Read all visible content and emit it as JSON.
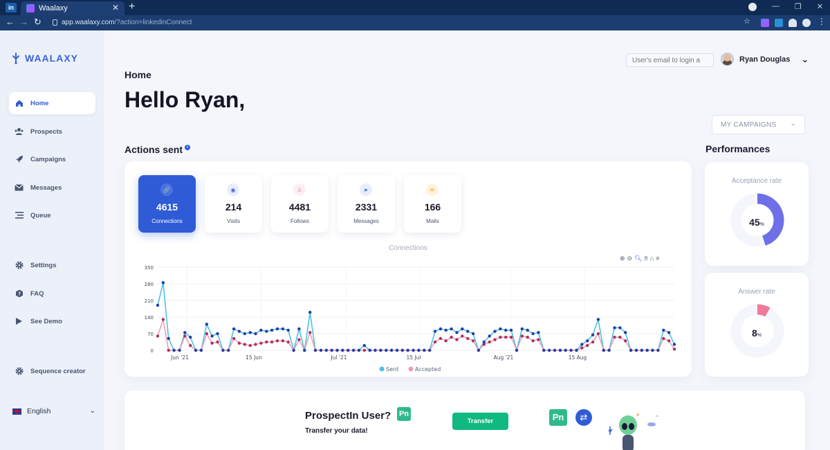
{
  "browser": {
    "tab_title": "Waalaxy",
    "url_host": "app.waalaxy.com",
    "url_path": "/?action=linkedinConnect"
  },
  "sidebar": {
    "logo_text": "WAALAXY",
    "items": [
      {
        "label": "Home",
        "icon": "home-icon",
        "active": true
      },
      {
        "label": "Prospects",
        "icon": "users-icon"
      },
      {
        "label": "Campaigns",
        "icon": "rocket-icon"
      },
      {
        "label": "Messages",
        "icon": "envelope-icon"
      },
      {
        "label": "Queue",
        "icon": "queue-icon"
      },
      {
        "label": "Settings",
        "icon": "gear-icon"
      },
      {
        "label": "FAQ",
        "icon": "question-icon"
      },
      {
        "label": "See Demo",
        "icon": "play-icon"
      },
      {
        "label": "Sequence creator",
        "icon": "gear-icon"
      }
    ],
    "language": "English"
  },
  "header": {
    "section_label": "Home",
    "greeting": "Hello Ryan,",
    "login_placeholder": "User's email to login a",
    "user_name": "Ryan Douglas"
  },
  "campaign_select": {
    "value": "MY CAMPAIGNS"
  },
  "actions": {
    "title": "Actions sent",
    "stats": [
      {
        "value": "4615",
        "label": "Connections",
        "active": true
      },
      {
        "value": "214",
        "label": "Visits"
      },
      {
        "value": "4481",
        "label": "Follows"
      },
      {
        "value": "2331",
        "label": "Messages"
      },
      {
        "value": "166",
        "label": "Mails"
      }
    ]
  },
  "performances": {
    "title": "Performances",
    "acceptance": {
      "label": "Acceptance rate",
      "value": "45",
      "unit": "%",
      "fraction": 0.45,
      "color": "#6f6fe8"
    },
    "answer": {
      "label": "Answer rate",
      "value": "8",
      "unit": "%",
      "fraction": 0.08,
      "color": "#f07a9a"
    }
  },
  "chart_data": {
    "type": "line",
    "title": "Connections",
    "ylim": [
      0,
      350
    ],
    "yticks": [
      0,
      70,
      140,
      210,
      280,
      350
    ],
    "x_tick_labels": [
      "Jun '21",
      "15 Jun",
      "Jul '21",
      "15 Jul",
      "Aug '21",
      "15 Aug"
    ],
    "series": [
      {
        "name": "Sent",
        "color": "#4fc1e0",
        "marker": "#1f3fa8",
        "values": [
          190,
          285,
          50,
          0,
          0,
          75,
          55,
          0,
          0,
          110,
          60,
          70,
          0,
          0,
          90,
          80,
          70,
          75,
          70,
          85,
          80,
          85,
          90,
          90,
          85,
          0,
          90,
          0,
          160,
          0,
          0,
          0,
          0,
          0,
          0,
          0,
          0,
          0,
          20,
          0,
          0,
          0,
          0,
          0,
          0,
          0,
          0,
          0,
          0,
          0,
          0,
          80,
          90,
          85,
          90,
          75,
          90,
          80,
          70,
          0,
          35,
          60,
          80,
          90,
          85,
          85,
          0,
          90,
          85,
          70,
          75,
          0,
          0,
          0,
          0,
          0,
          0,
          0,
          25,
          40,
          65,
          130,
          0,
          0,
          95,
          95,
          75,
          0,
          0,
          0,
          0,
          0,
          0,
          85,
          75,
          25
        ]
      },
      {
        "name": "Accepted",
        "color": "#e8a0b4",
        "marker": "#b03060",
        "values": [
          60,
          130,
          0,
          0,
          0,
          60,
          20,
          0,
          0,
          70,
          30,
          35,
          0,
          0,
          50,
          30,
          25,
          20,
          25,
          30,
          35,
          35,
          40,
          40,
          35,
          0,
          45,
          0,
          75,
          0,
          0,
          0,
          0,
          0,
          0,
          0,
          0,
          0,
          0,
          0,
          0,
          0,
          0,
          0,
          0,
          0,
          0,
          0,
          0,
          0,
          0,
          35,
          50,
          40,
          55,
          45,
          60,
          50,
          40,
          0,
          25,
          35,
          45,
          55,
          55,
          55,
          0,
          60,
          55,
          40,
          45,
          0,
          0,
          0,
          0,
          0,
          0,
          0,
          10,
          20,
          35,
          70,
          0,
          0,
          55,
          55,
          40,
          0,
          0,
          0,
          0,
          0,
          0,
          50,
          40,
          5
        ]
      }
    ]
  },
  "transfer": {
    "title": "ProspectIn User?",
    "badge": "Pn",
    "subtitle": "Transfer your data!",
    "button": "Transfer"
  }
}
